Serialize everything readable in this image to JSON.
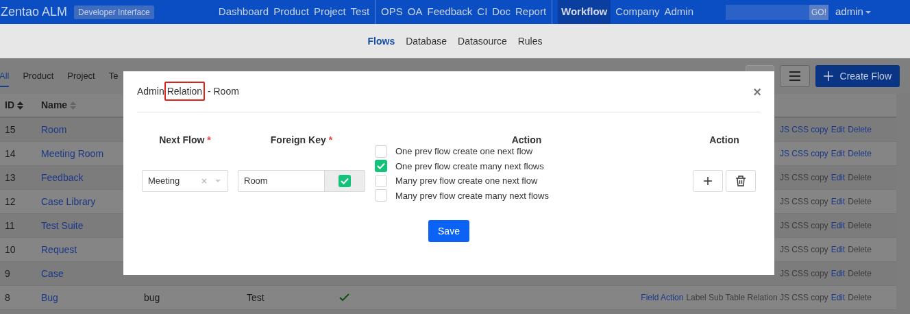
{
  "navbar": {
    "brand": "Zentao ALM",
    "badge": "Developer Interface",
    "groups": [
      [
        {
          "label": "Dashboard",
          "selected": false
        },
        {
          "label": "Product",
          "selected": false
        },
        {
          "label": "Project",
          "selected": false
        },
        {
          "label": "Test",
          "selected": false
        }
      ],
      [
        {
          "label": "OPS",
          "selected": false
        },
        {
          "label": "OA",
          "selected": false
        },
        {
          "label": "Feedback",
          "selected": false
        },
        {
          "label": "CI",
          "selected": false
        },
        {
          "label": "Doc",
          "selected": false
        },
        {
          "label": "Report",
          "selected": false
        }
      ],
      [
        {
          "label": "Workflow",
          "selected": true
        },
        {
          "label": "Company",
          "selected": false
        },
        {
          "label": "Admin",
          "selected": false
        }
      ]
    ],
    "search_button": "GO!",
    "user": "admin"
  },
  "subnav": [
    {
      "label": "Flows",
      "selected": true
    },
    {
      "label": "Database",
      "selected": false
    },
    {
      "label": "Datasource",
      "selected": false
    },
    {
      "label": "Rules",
      "selected": false
    }
  ],
  "filter_tabs": [
    {
      "label": "All",
      "selected": true
    },
    {
      "label": "Product",
      "selected": false
    },
    {
      "label": "Project",
      "selected": false
    },
    {
      "label": "Te",
      "selected": false
    }
  ],
  "create_button": "Create Flow",
  "table": {
    "columns": [
      "ID",
      "Name"
    ],
    "rows": [
      {
        "id": "15",
        "name": "Room",
        "actions": [
          {
            "text": "JS CSS copy",
            "link": true
          },
          {
            "text": "Edit",
            "link": true
          },
          {
            "text": "Delete",
            "link": true
          }
        ]
      },
      {
        "id": "14",
        "name": "Meeting Room",
        "actions": [
          {
            "text": "JS CSS copy",
            "link": true
          },
          {
            "text": "Edit",
            "link": true
          },
          {
            "text": "Delete",
            "link": true
          }
        ]
      },
      {
        "id": "13",
        "name": "Feedback",
        "actions": [
          {
            "text": "JS CSS copy",
            "link": false
          },
          {
            "text": "Edit",
            "link": true
          },
          {
            "text": "Delete",
            "link": false
          }
        ]
      },
      {
        "id": "12",
        "name": "Case Library",
        "actions": [
          {
            "text": "JS CSS copy",
            "link": false
          },
          {
            "text": "Edit",
            "link": true
          },
          {
            "text": "Delete",
            "link": false
          }
        ]
      },
      {
        "id": "11",
        "name": "Test Suite",
        "actions": [
          {
            "text": "JS CSS copy",
            "link": false
          },
          {
            "text": "Edit",
            "link": true
          },
          {
            "text": "Delete",
            "link": false
          }
        ]
      },
      {
        "id": "10",
        "name": "Request",
        "actions": [
          {
            "text": "JS CSS copy",
            "link": false
          },
          {
            "text": "Edit",
            "link": true
          },
          {
            "text": "Delete",
            "link": false
          }
        ]
      },
      {
        "id": "9",
        "name": "Case",
        "actions": [
          {
            "text": "JS CSS copy",
            "link": false
          },
          {
            "text": "Edit",
            "link": true
          },
          {
            "text": "Delete",
            "link": false
          }
        ]
      },
      {
        "id": "8",
        "name": "Bug",
        "code": "bug",
        "module": "Test",
        "enabled": true,
        "actions": [
          {
            "text": "Field Action",
            "link": true
          },
          {
            "text": "Label Sub Table Relation JS CSS copy",
            "link": false
          },
          {
            "text": "Edit",
            "link": true
          },
          {
            "text": "Delete",
            "link": false
          }
        ]
      }
    ]
  },
  "dialog": {
    "title_before": "Admin",
    "title_highlight": "Relation",
    "title_after": "- Room",
    "close": "×",
    "required_mark": "*",
    "headers": [
      {
        "label": "Next Flow",
        "required": true
      },
      {
        "label": "Foreign Key",
        "required": true
      },
      {
        "label": "Action",
        "required": false
      },
      {
        "label": "Action",
        "required": false
      }
    ],
    "next_flow": {
      "value": "Meeting"
    },
    "foreign_key": {
      "value": "Room",
      "checked": true
    },
    "options": [
      {
        "label": "One prev flow create one next flow",
        "checked": false
      },
      {
        "label": "One prev flow create many next flows",
        "checked": true
      },
      {
        "label": "Many prev flow create one next flow",
        "checked": false
      },
      {
        "label": "Many prev flow create many next flows",
        "checked": false
      }
    ],
    "save": "Save"
  }
}
